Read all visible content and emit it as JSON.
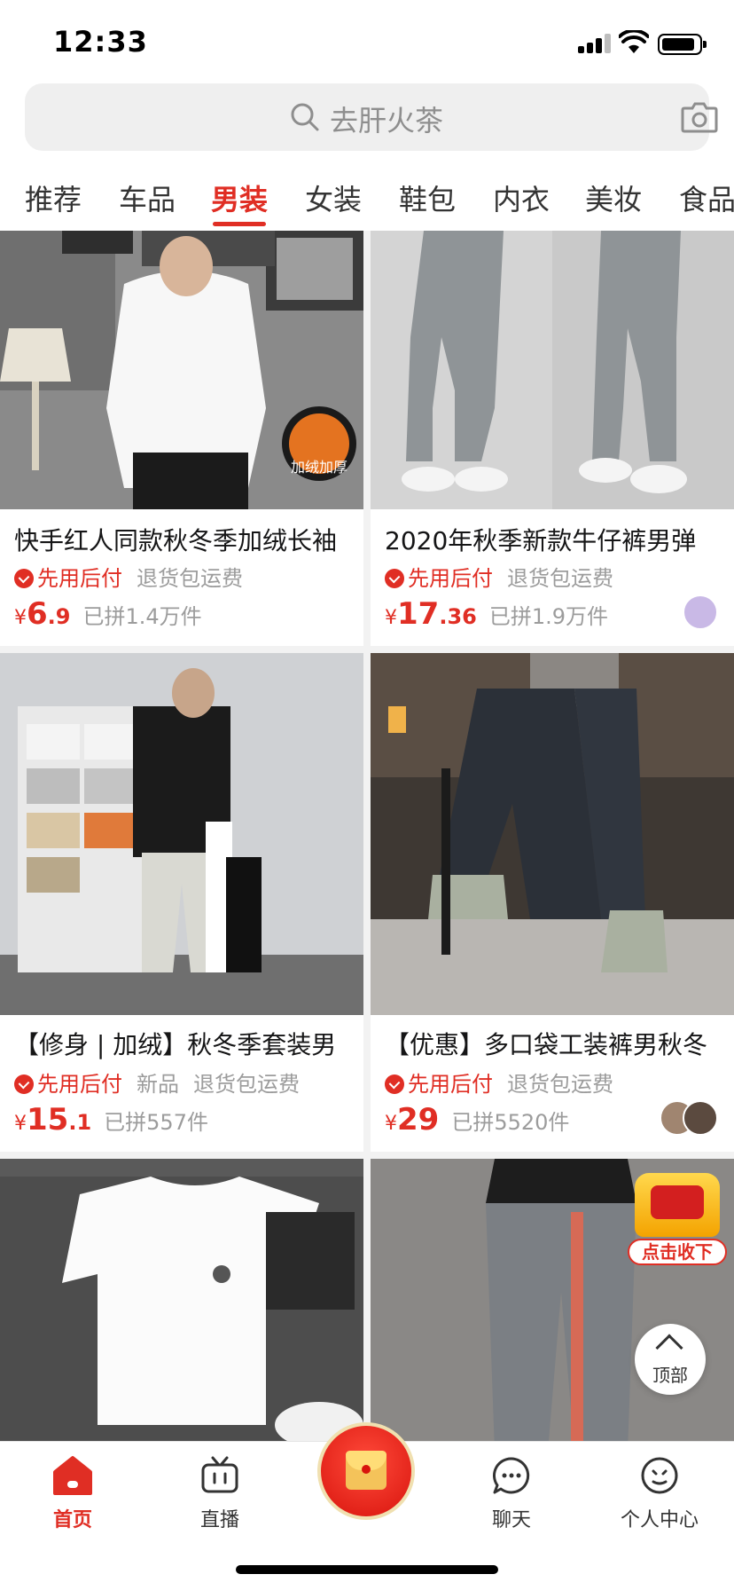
{
  "status_bar": {
    "time": "12:33"
  },
  "search": {
    "placeholder": "去肝火茶"
  },
  "tabs": [
    {
      "label": "推荐",
      "active": false
    },
    {
      "label": "车品",
      "active": false
    },
    {
      "label": "男装",
      "active": true
    },
    {
      "label": "女装",
      "active": false
    },
    {
      "label": "鞋包",
      "active": false
    },
    {
      "label": "内衣",
      "active": false
    },
    {
      "label": "美妆",
      "active": false
    },
    {
      "label": "食品",
      "active": false
    }
  ],
  "products": [
    {
      "title": "快手红人同款秋冬季加绒长袖",
      "pay_tag": "先用后付",
      "tags": [
        "退货包运费"
      ],
      "currency": "¥",
      "price_int": "6",
      "price_dec": ".9",
      "sold": "已拼1.4万件",
      "image_badge": "加绒加厚"
    },
    {
      "title": "2020年秋季新款牛仔裤男弹",
      "pay_tag": "先用后付",
      "tags": [
        "退货包运费"
      ],
      "currency": "¥",
      "price_int": "17",
      "price_dec": ".36",
      "sold": "已拼1.9万件"
    },
    {
      "title": "【修身 | 加绒】秋冬季套装男",
      "pay_tag": "先用后付",
      "tags": [
        "新品",
        "退货包运费"
      ],
      "currency": "¥",
      "price_int": "15",
      "price_dec": ".1",
      "sold": "已拼557件"
    },
    {
      "title": "【优惠】多口袋工装裤男秋冬",
      "pay_tag": "先用后付",
      "tags": [
        "退货包运费"
      ],
      "currency": "¥",
      "price_int": "29",
      "price_dec": "",
      "sold": "已拼5520件"
    },
    {
      "title": "",
      "pay_tag": "",
      "tags": [],
      "currency": "",
      "price_int": "",
      "price_dec": "",
      "sold": ""
    },
    {
      "title": "",
      "pay_tag": "",
      "tags": [],
      "currency": "",
      "price_int": "",
      "price_dec": "",
      "sold": ""
    }
  ],
  "floating": {
    "red_packet_label": "点击收下",
    "back_to_top_label": "顶部"
  },
  "bottom_nav": [
    {
      "label": "首页",
      "icon": "home-icon",
      "active": true
    },
    {
      "label": "直播",
      "icon": "tv-icon",
      "active": false
    },
    {
      "label": "",
      "icon": "red-envelope-icon",
      "active": false
    },
    {
      "label": "聊天",
      "icon": "chat-bubble-icon",
      "active": false
    },
    {
      "label": "个人中心",
      "icon": "profile-icon",
      "active": false
    }
  ],
  "colors": {
    "accent": "#e02e24",
    "muted_text": "#9c9c9c",
    "search_bg": "#efefef",
    "grid_bg": "#f2f2f2"
  }
}
